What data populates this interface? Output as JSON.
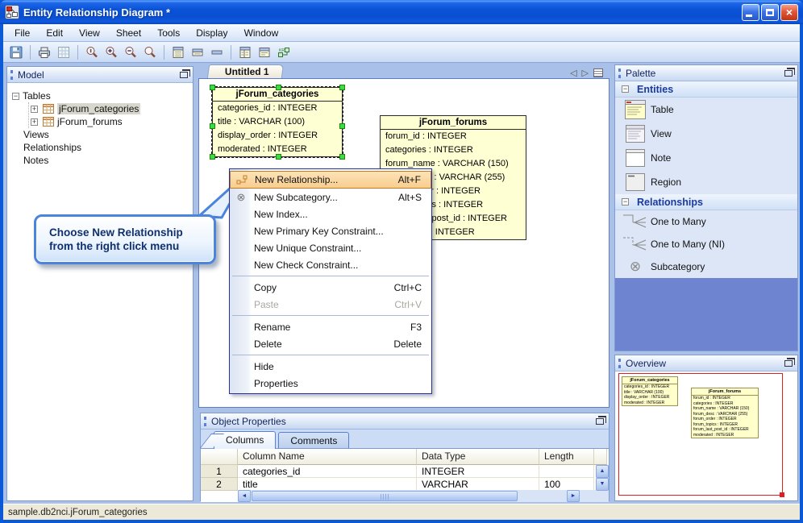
{
  "window": {
    "title": "Entity Relationship Diagram *"
  },
  "icons": {
    "close": "×",
    "nav_prev": "◁",
    "nav_next": "▷",
    "subcategory": "⊗",
    "scroll_up": "▲",
    "scroll_down": "▼",
    "scroll_left": "◄",
    "scroll_right": "►",
    "toolbar": [
      "save",
      "print",
      "grid",
      "zoom-actual",
      "zoom-in",
      "zoom-out",
      "zoom",
      "display-attributes",
      "display-names",
      "display-collapsed",
      "show-columns",
      "show-comments",
      "new-relationship-tool"
    ]
  },
  "menu_bar": {
    "items": [
      {
        "label": "File"
      },
      {
        "label": "Edit"
      },
      {
        "label": "View"
      },
      {
        "label": "Sheet"
      },
      {
        "label": "Tools"
      },
      {
        "label": "Display"
      },
      {
        "label": "Window"
      }
    ]
  },
  "model_panel": {
    "title": "Model",
    "tree": {
      "root": "Tables",
      "tables": [
        {
          "label": "jForum_categories",
          "selected": true
        },
        {
          "label": "jForum_forums"
        }
      ],
      "items": [
        {
          "label": "Views"
        },
        {
          "label": "Relationships"
        },
        {
          "label": "Notes"
        }
      ]
    }
  },
  "canvas": {
    "tab": "Untitled 1",
    "entities": [
      {
        "name": "jForum_categories",
        "selected": true,
        "fields": [
          "categories_id : INTEGER",
          "title : VARCHAR (100)",
          "display_order : INTEGER",
          "moderated : INTEGER"
        ]
      },
      {
        "name": "jForum_forums",
        "fields": [
          "forum_id : INTEGER",
          "categories : INTEGER",
          "forum_name : VARCHAR (150)",
          "forum_desc : VARCHAR (255)",
          "forum_order : INTEGER",
          "forum_topics : INTEGER",
          "forum_last_post_id : INTEGER",
          "moderated : INTEGER"
        ]
      }
    ]
  },
  "context_menu": {
    "items": [
      {
        "label": "New Relationship...",
        "shortcut": "Alt+F",
        "highlighted": true,
        "icon": "relationship-icon"
      },
      {
        "label": "New Subcategory...",
        "shortcut": "Alt+S",
        "icon": "subcategory-icon"
      },
      {
        "label": "New Index..."
      },
      {
        "label": "New Primary Key Constraint..."
      },
      {
        "label": "New Unique Constraint..."
      },
      {
        "label": "New Check Constraint..."
      },
      {
        "type": "separator"
      },
      {
        "label": "Copy",
        "shortcut": "Ctrl+C"
      },
      {
        "label": "Paste",
        "shortcut": "Ctrl+V",
        "disabled": true
      },
      {
        "type": "separator"
      },
      {
        "label": "Rename",
        "shortcut": "F3"
      },
      {
        "label": "Delete",
        "shortcut": "Delete"
      },
      {
        "type": "separator"
      },
      {
        "label": "Hide"
      },
      {
        "label": "Properties"
      }
    ]
  },
  "callout": {
    "line1": "Choose New Relationship",
    "line2": "from the right click menu"
  },
  "palette": {
    "title": "Palette",
    "sections": [
      {
        "label": "Entities",
        "items": [
          {
            "label": "Table"
          },
          {
            "label": "View"
          },
          {
            "label": "Note"
          },
          {
            "label": "Region"
          }
        ]
      },
      {
        "label": "Relationships",
        "items": [
          {
            "label": "One to Many"
          },
          {
            "label": "One to Many (NI)"
          },
          {
            "label": "Subcategory"
          }
        ]
      }
    ]
  },
  "overview": {
    "title": "Overview"
  },
  "object_properties": {
    "title": "Object Properties",
    "tabs": [
      {
        "label": "Columns",
        "active": true
      },
      {
        "label": "Comments"
      }
    ],
    "grid": {
      "headers": {
        "name": "Column Name",
        "type": "Data Type",
        "length": "Length"
      },
      "rows": [
        {
          "num": "1",
          "name": "categories_id",
          "type": "INTEGER",
          "length": ""
        },
        {
          "num": "2",
          "name": "title",
          "type": "VARCHAR",
          "length": "100"
        }
      ]
    }
  },
  "status_bar": {
    "text": "sample.db2nci.jForum_categories"
  },
  "colors": {
    "entity_fill": "#ffffd4",
    "selection_handle": "#3fdc3f",
    "menu_highlight": "#f8cd8e",
    "viewport_red": "#e02020",
    "callout_border": "#4b84dc",
    "titlebar_blue": "#0a52d6"
  }
}
